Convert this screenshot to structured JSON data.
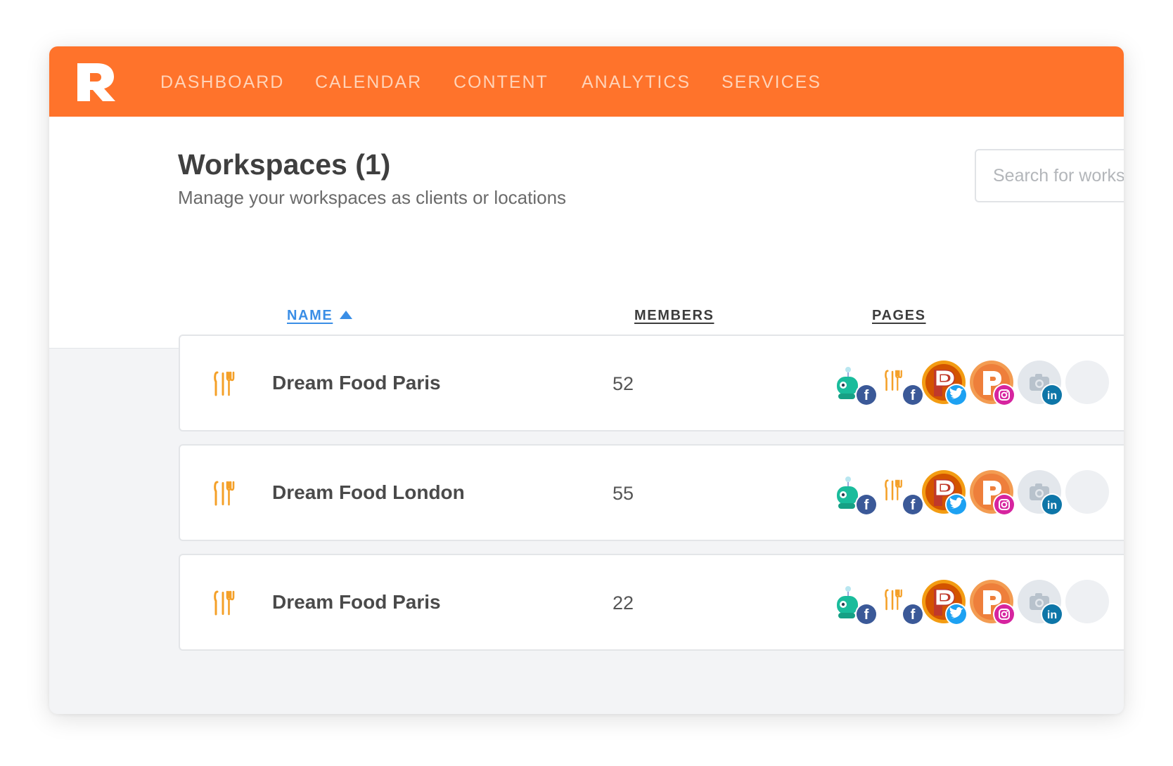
{
  "nav": {
    "items": [
      {
        "label": "DASHBOARD"
      },
      {
        "label": "CALENDAR"
      },
      {
        "label": "CONTENT"
      },
      {
        "label": "ANALYTICS"
      },
      {
        "label": "SERVICES"
      }
    ],
    "logo_icon": "brand-p-logo"
  },
  "header": {
    "title": "Workspaces (1)",
    "subtitle": "Manage your workspaces as clients or locations",
    "search_placeholder": "Search for workspaces"
  },
  "table": {
    "columns": {
      "name": "NAME",
      "members": "MEMBERS",
      "pages": "PAGES"
    },
    "sort": {
      "column": "name",
      "direction": "ascending"
    },
    "rows": [
      {
        "name": "Dream Food Paris",
        "members": "52",
        "icon": "restaurant-cutlery-icon",
        "pages": [
          {
            "avatar": "robot",
            "network": "facebook"
          },
          {
            "avatar": "cutlery",
            "network": "facebook"
          },
          {
            "avatar": "p-logo-red",
            "network": "twitter"
          },
          {
            "avatar": "p-logo-orange",
            "network": "instagram"
          },
          {
            "avatar": "camera-placeholder",
            "network": "linkedin"
          }
        ]
      },
      {
        "name": "Dream Food London",
        "members": "55",
        "icon": "restaurant-cutlery-icon",
        "pages": [
          {
            "avatar": "robot",
            "network": "facebook"
          },
          {
            "avatar": "cutlery",
            "network": "facebook"
          },
          {
            "avatar": "p-logo-red",
            "network": "twitter"
          },
          {
            "avatar": "p-logo-orange",
            "network": "instagram"
          },
          {
            "avatar": "camera-placeholder",
            "network": "linkedin"
          }
        ]
      },
      {
        "name": "Dream Food Paris",
        "members": "22",
        "icon": "restaurant-cutlery-icon",
        "pages": [
          {
            "avatar": "robot",
            "network": "facebook"
          },
          {
            "avatar": "cutlery",
            "network": "facebook"
          },
          {
            "avatar": "p-logo-red",
            "network": "twitter"
          },
          {
            "avatar": "p-logo-orange",
            "network": "instagram"
          },
          {
            "avatar": "camera-placeholder",
            "network": "linkedin"
          }
        ]
      }
    ]
  },
  "colors": {
    "brand_orange": "#ff732b",
    "nav_text": "#ffd3b8",
    "sort_active": "#3a8ee6",
    "cutlery_icon": "#f4a028",
    "facebook": "#3b5998",
    "twitter": "#1da1f2",
    "instagram": "#d6249f",
    "linkedin": "#0e76a8"
  }
}
